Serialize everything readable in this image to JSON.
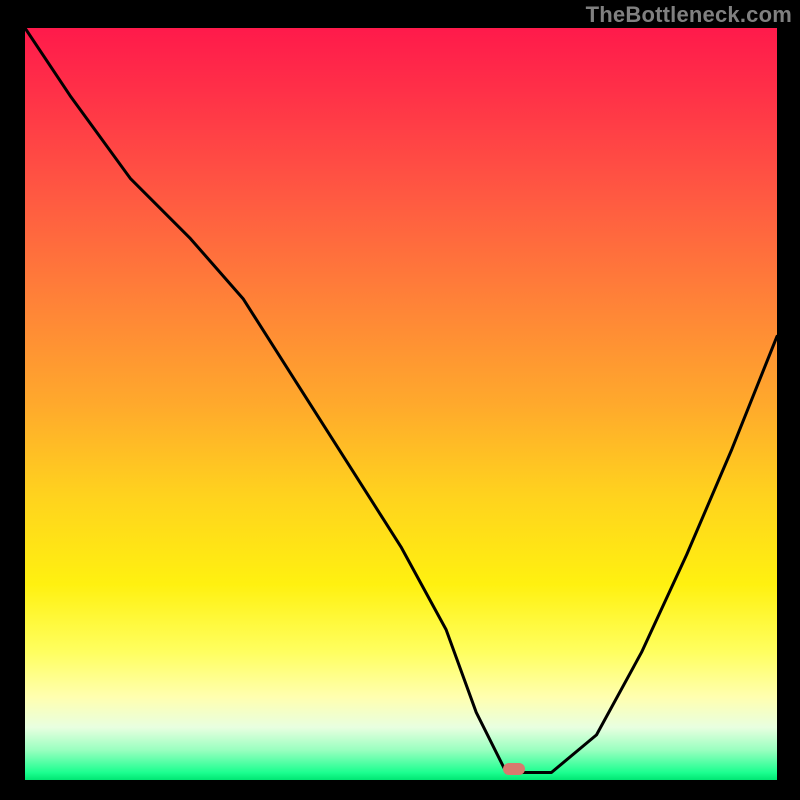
{
  "watermark": {
    "text": "TheBottleneck.com"
  },
  "plot": {
    "gradient_colors": [
      "#ff1a4b",
      "#ff5842",
      "#ffa92c",
      "#ffd21e",
      "#fff110",
      "#ffffb0",
      "#9affc0",
      "#00e673"
    ],
    "marker": {
      "color": "#d87a6e",
      "x_frac": 0.65,
      "y_frac": 0.985
    }
  },
  "chart_data": {
    "type": "line",
    "title": "",
    "xlabel": "",
    "ylabel": "",
    "xlim": [
      0,
      1
    ],
    "ylim": [
      0,
      1
    ],
    "annotations": [
      "TheBottleneck.com"
    ],
    "x": [
      0.0,
      0.06,
      0.14,
      0.22,
      0.29,
      0.36,
      0.43,
      0.5,
      0.56,
      0.6,
      0.64,
      0.7,
      0.76,
      0.82,
      0.88,
      0.94,
      1.0
    ],
    "values": [
      1.0,
      0.91,
      0.8,
      0.72,
      0.64,
      0.53,
      0.42,
      0.31,
      0.2,
      0.09,
      0.01,
      0.01,
      0.06,
      0.17,
      0.3,
      0.44,
      0.59
    ],
    "series": [
      {
        "name": "bottleneck-curve",
        "x": [
          0.0,
          0.06,
          0.14,
          0.22,
          0.29,
          0.36,
          0.43,
          0.5,
          0.56,
          0.6,
          0.64,
          0.7,
          0.76,
          0.82,
          0.88,
          0.94,
          1.0
        ],
        "values": [
          1.0,
          0.91,
          0.8,
          0.72,
          0.64,
          0.53,
          0.42,
          0.31,
          0.2,
          0.09,
          0.01,
          0.01,
          0.06,
          0.17,
          0.3,
          0.44,
          0.59
        ]
      }
    ],
    "marker_point": {
      "x": 0.65,
      "y": 0.005
    }
  }
}
